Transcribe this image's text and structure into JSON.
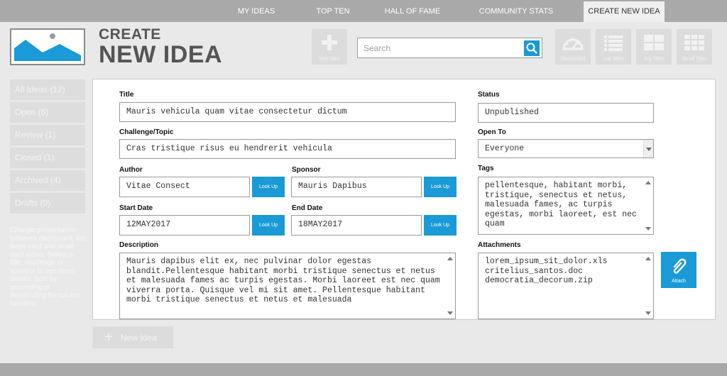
{
  "nav": {
    "items": [
      {
        "label": "MY IDEAS"
      },
      {
        "label": "TOP TEN"
      },
      {
        "label": "HALL OF FAME"
      },
      {
        "label": "COMMUNITY STATS"
      },
      {
        "label": "CREATE NEW IDEA",
        "active": true
      }
    ]
  },
  "header": {
    "title_line1": "CREATE",
    "title_line2": "NEW IDEA",
    "new_idea_label": "New Idea",
    "search_placeholder": "Search",
    "views": [
      {
        "label": "Dashboard",
        "icon": "dashboard-icon"
      },
      {
        "label": "List View",
        "icon": "list-icon"
      },
      {
        "label": "Big Tiles",
        "icon": "big-tiles-icon"
      },
      {
        "label": "Small Tiles",
        "icon": "small-tiles-icon"
      }
    ]
  },
  "sidebar": {
    "items": [
      {
        "label": "All Ideas (12)"
      },
      {
        "label": "Open (6)"
      },
      {
        "label": "Review (1)"
      },
      {
        "label": "Closed (1)"
      },
      {
        "label": "Archived (4)"
      },
      {
        "label": "Drafts (0)"
      }
    ],
    "help_text": "Change presentation between dashboard, list, large card and small card views. Select a title, challenge or sponsor to see more details. Sort by ascending or descending by column headers."
  },
  "form": {
    "title_label": "Title",
    "title_value": "Mauris vehicula quam vitae consectetur dictum",
    "challenge_label": "Challenge/Topic",
    "challenge_value": "Cras tristique risus eu hendrerit vehicula",
    "author_label": "Author",
    "author_value": "Vitae Consect",
    "sponsor_label": "Sponsor",
    "sponsor_value": "Mauris Dapibus",
    "lookup_label": "Look Up",
    "start_label": "Start Date",
    "start_value": "12MAY2017",
    "end_label": "End Date",
    "end_value": "18MAY2017",
    "description_label": "Description",
    "description_value": "Mauris dapibus elit ex, nec pulvinar dolor egestas blandit.Pellentesque habitant morbi tristique senectus et netus et malesuada fames ac turpis egestas. Morbi laoreet est nec quam viverra porta. Quisque vel mi sit amet. Pellentesque habitant morbi tristique senectus et netus et malesuada",
    "status_label": "Status",
    "status_value": "Unpublished",
    "open_to_label": "Open To",
    "open_to_value": "Everyone",
    "tags_label": "Tags",
    "tags_value": "pellentesque, habitant morbi, tristique, senectus et netus, malesuada fames, ac turpis egestas, morbi laoreet, est nec quam",
    "attachments_label": "Attachments",
    "attachments": [
      "lorem_ipsum_sit_dolor.xls",
      "critelius_santos.doc",
      "democratia_decorum.zip"
    ],
    "attach_label": "Attach"
  },
  "footer_button": {
    "label": "New Idea"
  },
  "colors": {
    "accent": "#1a9ad6",
    "nav_bg": "#a9a9a9",
    "disabled": "#dcdcdc"
  }
}
